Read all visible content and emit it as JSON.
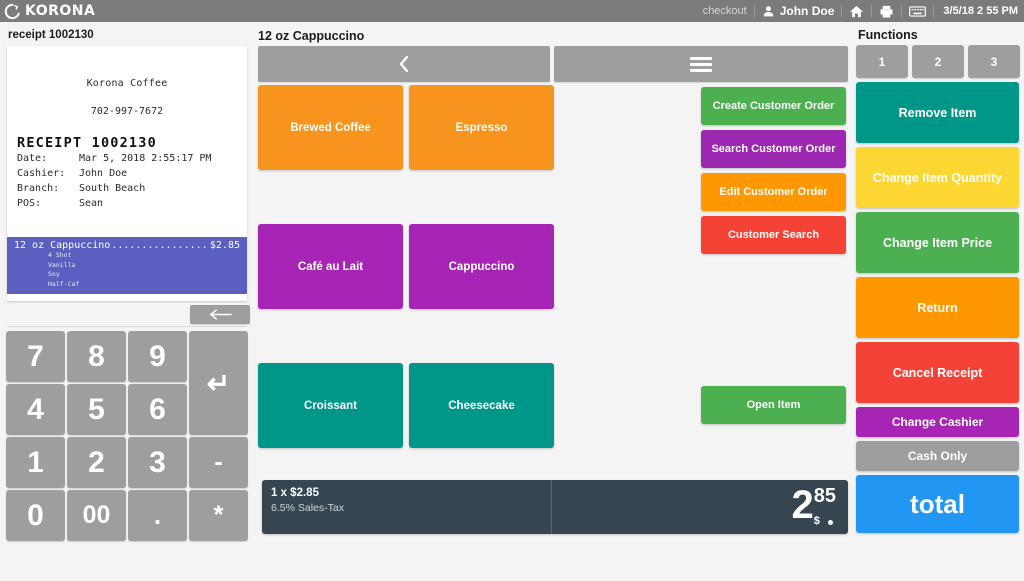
{
  "app": {
    "brand": "KORONA",
    "logo_icon": "korona-circle-icon"
  },
  "topbar": {
    "checkout_label": "checkout",
    "user_icon": "user-icon",
    "user_name": "John Doe",
    "home_icon": "home-icon",
    "print_icon": "printer-icon",
    "keyboard_icon": "keyboard-icon",
    "datetime": "3/5/18 2 55 PM",
    "background": "#7b7b7b"
  },
  "receipt_panel": {
    "header": "receipt 1002130",
    "store_name": "Korona Coffee",
    "phone": "702-997-7672",
    "title": "RECEIPT 1002130",
    "fields": [
      {
        "key": "Date:",
        "value": "Mar 5, 2018 2:55:17 PM"
      },
      {
        "key": "Cashier:",
        "value": "John Doe"
      },
      {
        "key": "Branch:",
        "value": "South Beach"
      },
      {
        "key": "POS:",
        "value": "Sean"
      }
    ],
    "selected_line": {
      "name": "12 oz Cappuccino",
      "dots": "...................",
      "price": "$2.85",
      "highlight_color": "#5a5fc0",
      "modifiers": [
        "4 Shot",
        "Vanilla",
        "Soy",
        "Half-Caf"
      ]
    },
    "back_button_icon": "arrow-left-icon"
  },
  "keypad": {
    "keys": [
      {
        "label": "7",
        "name": "key-7"
      },
      {
        "label": "8",
        "name": "key-8"
      },
      {
        "label": "9",
        "name": "key-9"
      },
      {
        "label": "↵",
        "name": "key-enter"
      },
      {
        "label": "4",
        "name": "key-4"
      },
      {
        "label": "5",
        "name": "key-5"
      },
      {
        "label": "6",
        "name": "key-6"
      },
      {
        "label": "1",
        "name": "key-1"
      },
      {
        "label": "2",
        "name": "key-2"
      },
      {
        "label": "3",
        "name": "key-3"
      },
      {
        "label": "-",
        "name": "key-minus"
      },
      {
        "label": "0",
        "name": "key-0"
      },
      {
        "label": "00",
        "name": "key-double-zero"
      },
      {
        "label": ".",
        "name": "key-decimal"
      },
      {
        "label": "*",
        "name": "key-asterisk"
      }
    ]
  },
  "product_panel": {
    "header": "12 oz Cappuccino",
    "nav_back_icon": "chevron-left-icon",
    "menu_icon": "hamburger-menu-icon",
    "tiles": [
      {
        "label": "Brewed Coffee",
        "color": "#f7941d"
      },
      {
        "label": "Espresso",
        "color": "#f7941d"
      },
      {
        "label": "Café au Lait",
        "color": "#a625b5"
      },
      {
        "label": "Cappuccino",
        "color": "#a625b5"
      },
      {
        "label": "Croissant",
        "color": "#009688"
      },
      {
        "label": "Cheesecake",
        "color": "#009688"
      }
    ],
    "customer_buttons": [
      {
        "label": "Create Customer Order",
        "color": "#4caf50"
      },
      {
        "label": "Search Customer Order",
        "color": "#9c27b0"
      },
      {
        "label": "Edit Customer Order",
        "color": "#ff9800"
      },
      {
        "label": "Customer Search",
        "color": "#f44336"
      }
    ],
    "open_item": {
      "label": "Open Item",
      "color": "#4caf50"
    }
  },
  "total_bar": {
    "quantity_line": "1 x $2.85",
    "tax_line": "6.5% Sales-Tax",
    "amount_integer": "2",
    "amount_cents": "85",
    "currency": "$",
    "background": "#36454f"
  },
  "functions_panel": {
    "header": "Functions",
    "number_buttons": [
      {
        "label": "1"
      },
      {
        "label": "2"
      },
      {
        "label": "3"
      }
    ],
    "buttons": [
      {
        "label": "Remove Item",
        "color": "#009688",
        "size": "lg"
      },
      {
        "label": "Change Item Quantity",
        "color": "#fcd633",
        "size": "lg"
      },
      {
        "label": "Change Item Price",
        "color": "#4caf50",
        "size": "lg"
      },
      {
        "label": "Return",
        "color": "#ff9800",
        "size": "lg"
      },
      {
        "label": "Cancel Receipt",
        "color": "#f44336",
        "size": "lg"
      },
      {
        "label": "Change Cashier",
        "color": "#a625b5",
        "size": "md"
      },
      {
        "label": "Cash Only",
        "color": "#9e9e9e",
        "size": "md"
      }
    ],
    "total_button": {
      "label": "total",
      "color": "#2196f3"
    }
  }
}
